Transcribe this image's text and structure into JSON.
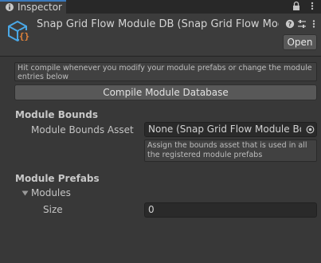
{
  "tab": {
    "title": "Inspector",
    "icon": "info-icon"
  },
  "tab_toolbar": {
    "lock_icon": "lock-icon",
    "menu_icon": "kebab-menu-icon"
  },
  "header": {
    "title": "Snap Grid Flow Module DB (Snap Grid Flow Mod",
    "asset_icon": "scriptable-object-icon",
    "help_icon": "help-icon",
    "presets_icon": "presets-icon",
    "menu_icon": "kebab-menu-icon",
    "open_label": "Open"
  },
  "help_text": "Hit compile whenever you modify your module prefabs or change the module entries below",
  "compile_button_label": "Compile Module Database",
  "module_bounds": {
    "section_title": "Module Bounds",
    "asset_label": "Module Bounds Asset",
    "asset_value": "None (Snap Grid Flow Module Boun",
    "picker_icon": "object-picker-icon",
    "tooltip": "Assign the bounds asset that is used in all the registered module prefabs"
  },
  "module_prefabs": {
    "section_title": "Module Prefabs",
    "modules_label": "Modules",
    "foldout_icon": "triangle-down-icon",
    "size_label": "Size",
    "size_value": "0"
  },
  "colors": {
    "background": "#383838",
    "tab_accent": "#3a79bb",
    "asset_icon_blue": "#4aa8e6",
    "asset_icon_orange": "#e8853a"
  }
}
